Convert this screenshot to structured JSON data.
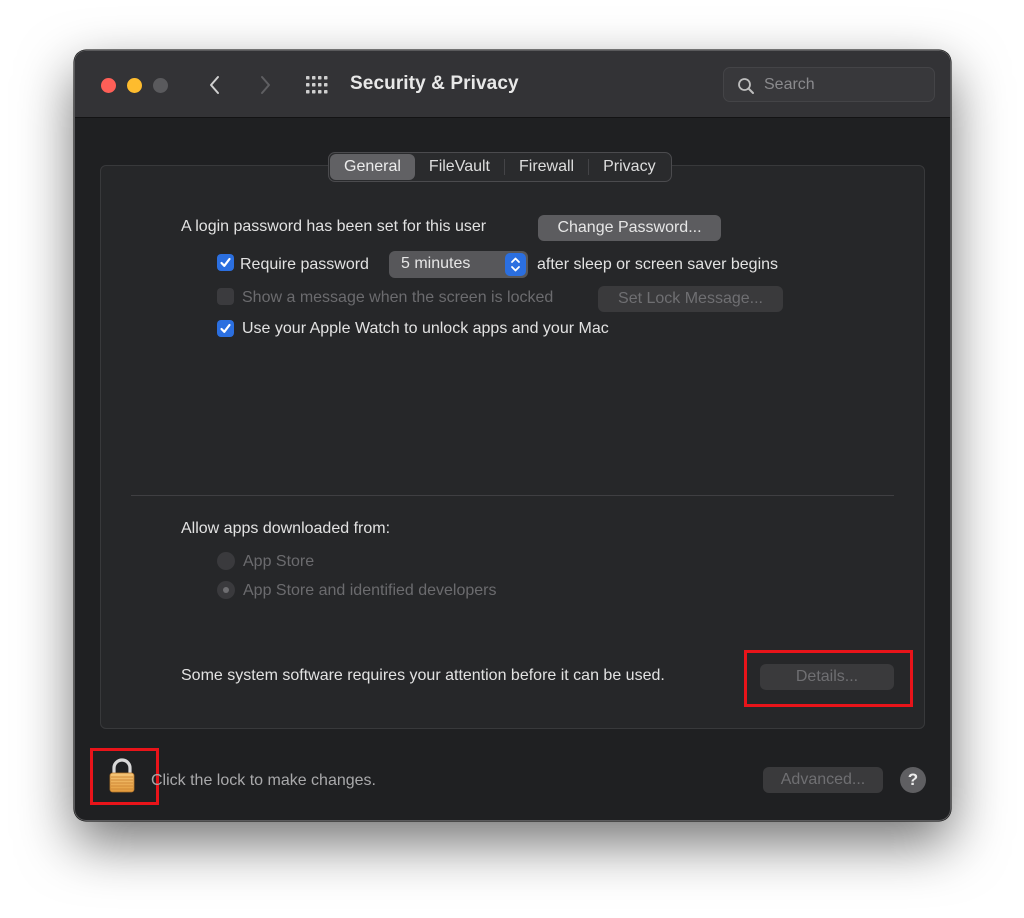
{
  "window": {
    "title": "Security & Privacy",
    "traffic_lights": {
      "close": "#fe5f57",
      "minimize": "#febc2e",
      "zoom": "#5a5a5d"
    },
    "nav": {
      "back_icon": "chevron-left-icon",
      "forward_icon": "chevron-right-icon",
      "grid_icon": "show-all-grid-icon"
    },
    "search": {
      "placeholder": "Search",
      "value": ""
    }
  },
  "tabs": [
    {
      "label": "General",
      "active": true
    },
    {
      "label": "FileVault",
      "active": false
    },
    {
      "label": "Firewall",
      "active": false
    },
    {
      "label": "Privacy",
      "active": false
    }
  ],
  "general": {
    "login_password_text": "A login password has been set for this user",
    "change_password_button": "Change Password...",
    "require_password": {
      "label": "Require password",
      "checked": true,
      "interval": "5 minutes",
      "suffix": "after sleep or screen saver begins"
    },
    "show_message": {
      "label": "Show a message when the screen is locked",
      "checked": false,
      "enabled": false,
      "button": "Set Lock Message..."
    },
    "apple_watch": {
      "label": "Use your Apple Watch to unlock apps and your Mac",
      "checked": true
    }
  },
  "allow_apps": {
    "label": "Allow apps downloaded from:",
    "options": [
      {
        "label": "App Store",
        "selected": false,
        "enabled": false
      },
      {
        "label": "App Store and identified developers",
        "selected": true,
        "enabled": false
      }
    ]
  },
  "system_software": {
    "text": "Some system software requires your attention before it can be used.",
    "details_button": "Details..."
  },
  "footer": {
    "lock_text": "Click the lock to make changes.",
    "advanced_button": "Advanced...",
    "help_label": "?"
  },
  "annotation_color": "#e8141a",
  "accent_color": "#2b6fe0"
}
